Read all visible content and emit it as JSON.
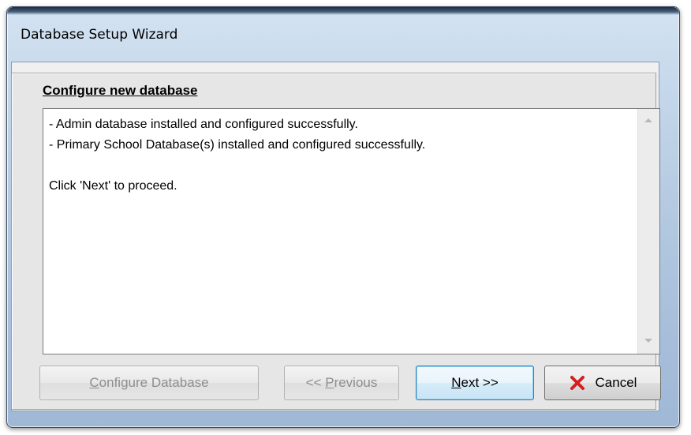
{
  "window": {
    "title": "Database Setup Wizard"
  },
  "section": {
    "heading": "Configure new database"
  },
  "log": {
    "lines": [
      "- Admin database installed and configured successfully.",
      "- Primary School Database(s) installed and configured successfully.",
      "",
      "Click 'Next' to proceed."
    ]
  },
  "buttons": {
    "configure": {
      "mnemonic": "C",
      "rest": "onfigure Database",
      "enabled": false
    },
    "previous": {
      "before": "<< ",
      "mnemonic": "P",
      "rest": "revious",
      "enabled": false
    },
    "next": {
      "mnemonic": "N",
      "rest": "ext >>",
      "enabled": true
    },
    "cancel": {
      "label": "Cancel",
      "icon": "close-icon",
      "enabled": true
    }
  },
  "colors": {
    "cancel_icon": "#d42020",
    "default_button_border": "#3c7fb1"
  }
}
